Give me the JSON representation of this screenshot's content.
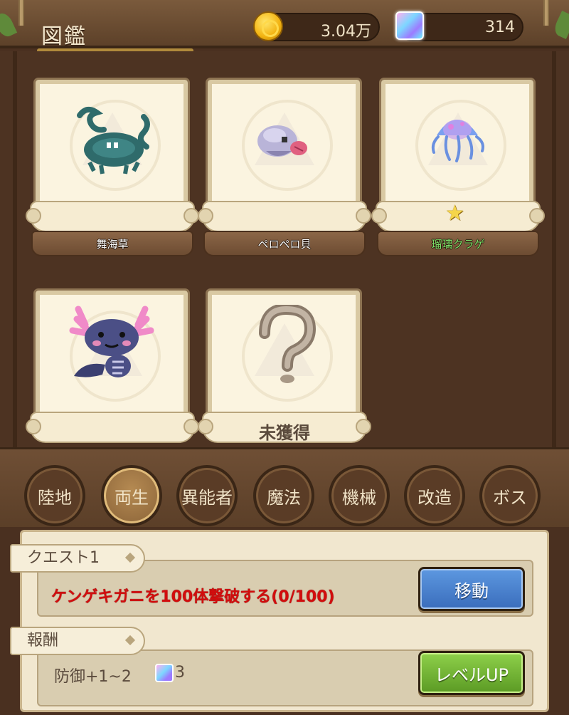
{
  "header": {
    "title": "図鑑",
    "gold_value": "3.04万",
    "gem_value": "314"
  },
  "cards": [
    {
      "name": "舞海草",
      "state": "owned",
      "art": "seaweed-monster"
    },
    {
      "name": "ペロペロ貝",
      "state": "owned",
      "art": "tongue-shell"
    },
    {
      "name": "瑠璃クラゲ",
      "state": "owned-starred",
      "art": "jellyfish"
    },
    {
      "name": "",
      "state": "owned",
      "art": "axolotl"
    },
    {
      "name": "",
      "state": "unowned",
      "art": "question-mark",
      "unowned_label": "未獲得"
    }
  ],
  "categories": [
    {
      "label": "陸地",
      "active": false
    },
    {
      "label": "両生",
      "active": true
    },
    {
      "label": "異能者",
      "active": false
    },
    {
      "label": "魔法",
      "active": false
    },
    {
      "label": "機械",
      "active": false
    },
    {
      "label": "改造",
      "active": false
    },
    {
      "label": "ボス",
      "active": false
    }
  ],
  "quest": {
    "tag": "クエスト1",
    "text": "ケンゲキガニを100体撃破する(0/100)",
    "button": "移動"
  },
  "reward": {
    "tag": "報酬",
    "text": "防御+1~2",
    "gem_count": "3",
    "button": "レベルUP"
  },
  "colors": {
    "quest_text": "#d20d0d",
    "starred_name": "#7de36a",
    "move_button": "#3a6dbc",
    "level_button": "#5b9a24"
  }
}
